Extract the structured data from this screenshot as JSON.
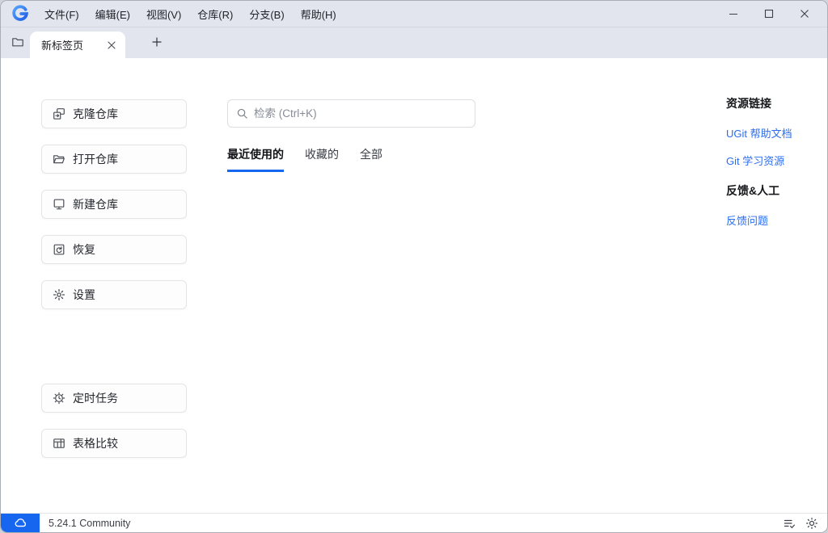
{
  "app": {
    "logo_letter": "G",
    "accent_color": "#1766f0",
    "link_color": "#2a6df2",
    "bar_background": "#e2e5ee"
  },
  "menubar": {
    "items": [
      {
        "label": "文件(F)"
      },
      {
        "label": "编辑(E)"
      },
      {
        "label": "视图(V)"
      },
      {
        "label": "仓库(R)"
      },
      {
        "label": "分支(B)"
      },
      {
        "label": "帮助(H)"
      }
    ],
    "window_controls": [
      "minimize-icon",
      "maximize-icon",
      "close-icon"
    ]
  },
  "tabbar": {
    "tab": {
      "label": "新标签页",
      "close_icon": "close-icon"
    },
    "icons": [
      "folder-icon",
      "plus-icon"
    ]
  },
  "sidebar": {
    "buttons": [
      {
        "label": "克隆仓库",
        "icon": "clone-repo-icon"
      },
      {
        "label": "打开仓库",
        "icon": "open-repo-icon"
      },
      {
        "label": "新建仓库",
        "icon": "new-repo-icon"
      },
      {
        "label": "恢复",
        "icon": "restore-icon"
      },
      {
        "label": "设置",
        "icon": "gear-icon"
      },
      {
        "label": "定时任务",
        "icon": "scheduled-task-icon"
      },
      {
        "label": "表格比较",
        "icon": "table-compare-icon"
      }
    ]
  },
  "main": {
    "search": {
      "placeholder": "检索 (Ctrl+K)",
      "icon": "search-icon"
    },
    "tabs": [
      {
        "label": "最近使用的",
        "active": true
      },
      {
        "label": "收藏的",
        "active": false
      },
      {
        "label": "全部",
        "active": false
      }
    ]
  },
  "right_panel": {
    "sections": [
      {
        "title": "资源链接",
        "links": [
          "UGit 帮助文档",
          "Git 学习资源"
        ]
      },
      {
        "title": "反馈&人工",
        "links": [
          "反馈问题"
        ]
      }
    ]
  },
  "statusbar": {
    "version": "5.24.1 Community",
    "icons": [
      "cloud-icon",
      "changelog-check-icon",
      "theme-light-icon"
    ]
  }
}
